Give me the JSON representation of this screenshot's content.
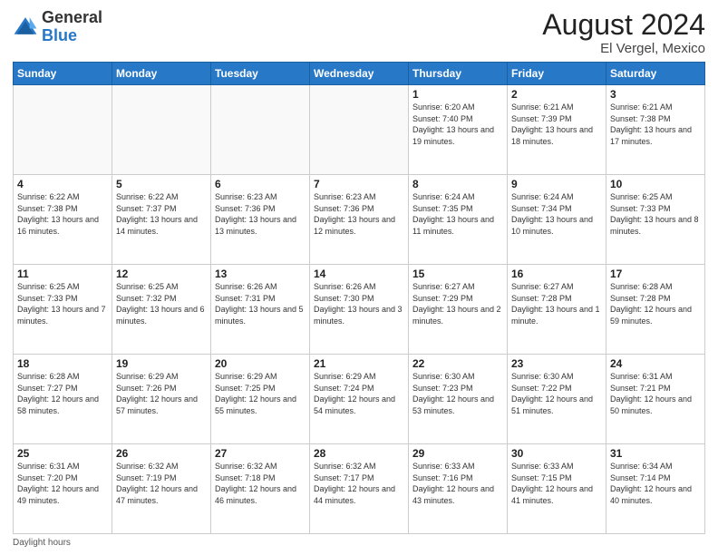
{
  "header": {
    "logo_general": "General",
    "logo_blue": "Blue",
    "month_year": "August 2024",
    "location": "El Vergel, Mexico"
  },
  "days_of_week": [
    "Sunday",
    "Monday",
    "Tuesday",
    "Wednesday",
    "Thursday",
    "Friday",
    "Saturday"
  ],
  "weeks": [
    [
      {
        "day": "",
        "info": ""
      },
      {
        "day": "",
        "info": ""
      },
      {
        "day": "",
        "info": ""
      },
      {
        "day": "",
        "info": ""
      },
      {
        "day": "1",
        "info": "Sunrise: 6:20 AM\nSunset: 7:40 PM\nDaylight: 13 hours\nand 19 minutes."
      },
      {
        "day": "2",
        "info": "Sunrise: 6:21 AM\nSunset: 7:39 PM\nDaylight: 13 hours\nand 18 minutes."
      },
      {
        "day": "3",
        "info": "Sunrise: 6:21 AM\nSunset: 7:38 PM\nDaylight: 13 hours\nand 17 minutes."
      }
    ],
    [
      {
        "day": "4",
        "info": "Sunrise: 6:22 AM\nSunset: 7:38 PM\nDaylight: 13 hours\nand 16 minutes."
      },
      {
        "day": "5",
        "info": "Sunrise: 6:22 AM\nSunset: 7:37 PM\nDaylight: 13 hours\nand 14 minutes."
      },
      {
        "day": "6",
        "info": "Sunrise: 6:23 AM\nSunset: 7:36 PM\nDaylight: 13 hours\nand 13 minutes."
      },
      {
        "day": "7",
        "info": "Sunrise: 6:23 AM\nSunset: 7:36 PM\nDaylight: 13 hours\nand 12 minutes."
      },
      {
        "day": "8",
        "info": "Sunrise: 6:24 AM\nSunset: 7:35 PM\nDaylight: 13 hours\nand 11 minutes."
      },
      {
        "day": "9",
        "info": "Sunrise: 6:24 AM\nSunset: 7:34 PM\nDaylight: 13 hours\nand 10 minutes."
      },
      {
        "day": "10",
        "info": "Sunrise: 6:25 AM\nSunset: 7:33 PM\nDaylight: 13 hours\nand 8 minutes."
      }
    ],
    [
      {
        "day": "11",
        "info": "Sunrise: 6:25 AM\nSunset: 7:33 PM\nDaylight: 13 hours\nand 7 minutes."
      },
      {
        "day": "12",
        "info": "Sunrise: 6:25 AM\nSunset: 7:32 PM\nDaylight: 13 hours\nand 6 minutes."
      },
      {
        "day": "13",
        "info": "Sunrise: 6:26 AM\nSunset: 7:31 PM\nDaylight: 13 hours\nand 5 minutes."
      },
      {
        "day": "14",
        "info": "Sunrise: 6:26 AM\nSunset: 7:30 PM\nDaylight: 13 hours\nand 3 minutes."
      },
      {
        "day": "15",
        "info": "Sunrise: 6:27 AM\nSunset: 7:29 PM\nDaylight: 13 hours\nand 2 minutes."
      },
      {
        "day": "16",
        "info": "Sunrise: 6:27 AM\nSunset: 7:28 PM\nDaylight: 13 hours\nand 1 minute."
      },
      {
        "day": "17",
        "info": "Sunrise: 6:28 AM\nSunset: 7:28 PM\nDaylight: 12 hours\nand 59 minutes."
      }
    ],
    [
      {
        "day": "18",
        "info": "Sunrise: 6:28 AM\nSunset: 7:27 PM\nDaylight: 12 hours\nand 58 minutes."
      },
      {
        "day": "19",
        "info": "Sunrise: 6:29 AM\nSunset: 7:26 PM\nDaylight: 12 hours\nand 57 minutes."
      },
      {
        "day": "20",
        "info": "Sunrise: 6:29 AM\nSunset: 7:25 PM\nDaylight: 12 hours\nand 55 minutes."
      },
      {
        "day": "21",
        "info": "Sunrise: 6:29 AM\nSunset: 7:24 PM\nDaylight: 12 hours\nand 54 minutes."
      },
      {
        "day": "22",
        "info": "Sunrise: 6:30 AM\nSunset: 7:23 PM\nDaylight: 12 hours\nand 53 minutes."
      },
      {
        "day": "23",
        "info": "Sunrise: 6:30 AM\nSunset: 7:22 PM\nDaylight: 12 hours\nand 51 minutes."
      },
      {
        "day": "24",
        "info": "Sunrise: 6:31 AM\nSunset: 7:21 PM\nDaylight: 12 hours\nand 50 minutes."
      }
    ],
    [
      {
        "day": "25",
        "info": "Sunrise: 6:31 AM\nSunset: 7:20 PM\nDaylight: 12 hours\nand 49 minutes."
      },
      {
        "day": "26",
        "info": "Sunrise: 6:32 AM\nSunset: 7:19 PM\nDaylight: 12 hours\nand 47 minutes."
      },
      {
        "day": "27",
        "info": "Sunrise: 6:32 AM\nSunset: 7:18 PM\nDaylight: 12 hours\nand 46 minutes."
      },
      {
        "day": "28",
        "info": "Sunrise: 6:32 AM\nSunset: 7:17 PM\nDaylight: 12 hours\nand 44 minutes."
      },
      {
        "day": "29",
        "info": "Sunrise: 6:33 AM\nSunset: 7:16 PM\nDaylight: 12 hours\nand 43 minutes."
      },
      {
        "day": "30",
        "info": "Sunrise: 6:33 AM\nSunset: 7:15 PM\nDaylight: 12 hours\nand 41 minutes."
      },
      {
        "day": "31",
        "info": "Sunrise: 6:34 AM\nSunset: 7:14 PM\nDaylight: 12 hours\nand 40 minutes."
      }
    ]
  ],
  "footer": {
    "note": "Daylight hours"
  }
}
